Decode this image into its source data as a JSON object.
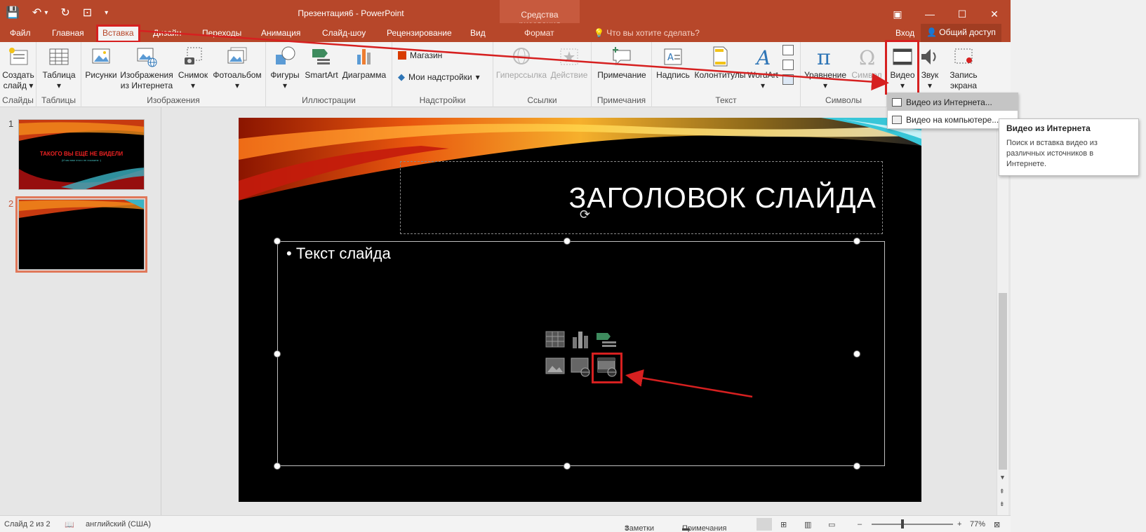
{
  "window": {
    "title": "Презентация6 - PowerPoint",
    "contextual_group": "Средства рисования",
    "contextual_tab": "Формат",
    "controls": {
      "ribbon_display": "▣",
      "minimize": "—",
      "maximize": "☐",
      "close": "✕"
    }
  },
  "qat": {
    "save": "💾",
    "undo": "↶",
    "undo_more": "▾",
    "redo": "↻",
    "from_start": "⊡",
    "customize": "▾"
  },
  "tabs": {
    "file": "Файл",
    "home": "Главная",
    "insert": "Вставка",
    "design": "Дизайн",
    "transitions": "Переходы",
    "animations": "Анимация",
    "slideshow": "Слайд-шоу",
    "review": "Рецензирование",
    "view": "Вид"
  },
  "tell_me": "Что вы хотите сделать?",
  "tell_me_icon": "lightbulb-icon",
  "login": "Вход",
  "share": "Общий доступ",
  "ribbon": {
    "slides": {
      "label": "Слайды",
      "new_slide": "Создать",
      "new_slide_2": "слайд ▾"
    },
    "tables": {
      "label": "Таблицы",
      "table": "Таблица",
      "table_arrow": "▾"
    },
    "images": {
      "label": "Изображения",
      "pictures": "Рисунки",
      "online": "Изображения",
      "online_2": "из Интернета",
      "screenshot": "Снимок",
      "screenshot_arrow": "▾",
      "album": "Фотоальбом",
      "album_arrow": "▾"
    },
    "illustrations": {
      "label": "Иллюстрации",
      "shapes": "Фигуры",
      "shapes_arrow": "▾",
      "smartart": "SmartArt",
      "chart": "Диаграмма"
    },
    "addins": {
      "label": "Надстройки",
      "store": "Магазин",
      "my_addins": "Мои надстройки",
      "my_addins_arrow": "▾"
    },
    "links": {
      "label": "Ссылки",
      "hyperlink": "Гиперссылка",
      "action": "Действие"
    },
    "comments": {
      "label": "Примечания",
      "comment": "Примечание"
    },
    "text": {
      "label": "Текст",
      "textbox": "Надпись",
      "header_footer": "Колонтитулы",
      "wordart": "WordArt",
      "wordart_arrow": "▾"
    },
    "symbols": {
      "label": "Символы",
      "equation": "Уравнение",
      "equation_arrow": "▾",
      "symbol": "Символ"
    },
    "media": {
      "video": "Видео",
      "video_arrow": "▾",
      "audio": "Звук",
      "audio_arrow": "▾",
      "screen_rec": "Запись",
      "screen_rec_2": "экрана"
    }
  },
  "video_menu": {
    "online": "Видео из Интернета...",
    "pc": "Видео на компьютере..."
  },
  "tooltip": {
    "title": "Видео из Интернета",
    "text": "Поиск и вставка видео из различных источников в Интернете."
  },
  "thumbnails": [
    {
      "num": "1",
      "title": "ТАКОГО ВЫ ЕЩЁ НЕ ВИДЕЛИ",
      "subtitle": "(И мы вам этого не покажем :)"
    },
    {
      "num": "2"
    }
  ],
  "slide": {
    "title": "ЗАГОЛОВОК СЛАЙДА",
    "body": "• Текст слайда"
  },
  "scrollbar": {
    "up": "▲",
    "down": "▼",
    "prev": "⇞",
    "next": "⇟"
  },
  "status": {
    "slide_info": "Слайд 2 из 2",
    "language": "английский (США)",
    "notes": "Заметки",
    "comments": "Примечания",
    "zoom_minus": "–",
    "zoom_plus": "+",
    "zoom": "77%",
    "fit": "⊠"
  },
  "colors": {
    "accent": "#b7472a",
    "highlight": "#d62020"
  }
}
